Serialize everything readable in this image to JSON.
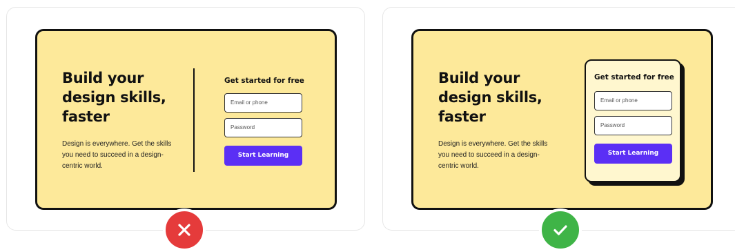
{
  "examples": {
    "bad": {
      "headline": "Build your design skills, faster",
      "body": "Design is everywhere. Get the skills you need to succeed in a design-centric world.",
      "form_title": "Get started for free",
      "email_placeholder": "Email or phone",
      "password_placeholder": "Password",
      "cta_label": "Start Learning",
      "badge_icon": "x-mark-icon",
      "badge_color": "#e53b3b"
    },
    "good": {
      "headline": "Build your design skills, faster",
      "body": "Design is everywhere. Get the skills you need to succeed in a design-centric world.",
      "form_title": "Get started for free",
      "email_placeholder": "Email or phone",
      "password_placeholder": "Password",
      "cta_label": "Start Learning",
      "badge_icon": "checkmark-icon",
      "badge_color": "#3fb447"
    }
  },
  "colors": {
    "card_background": "#fde99a",
    "form_box_background": "#fff7cf",
    "cta_background": "#5b2ff5",
    "border": "#111111"
  }
}
